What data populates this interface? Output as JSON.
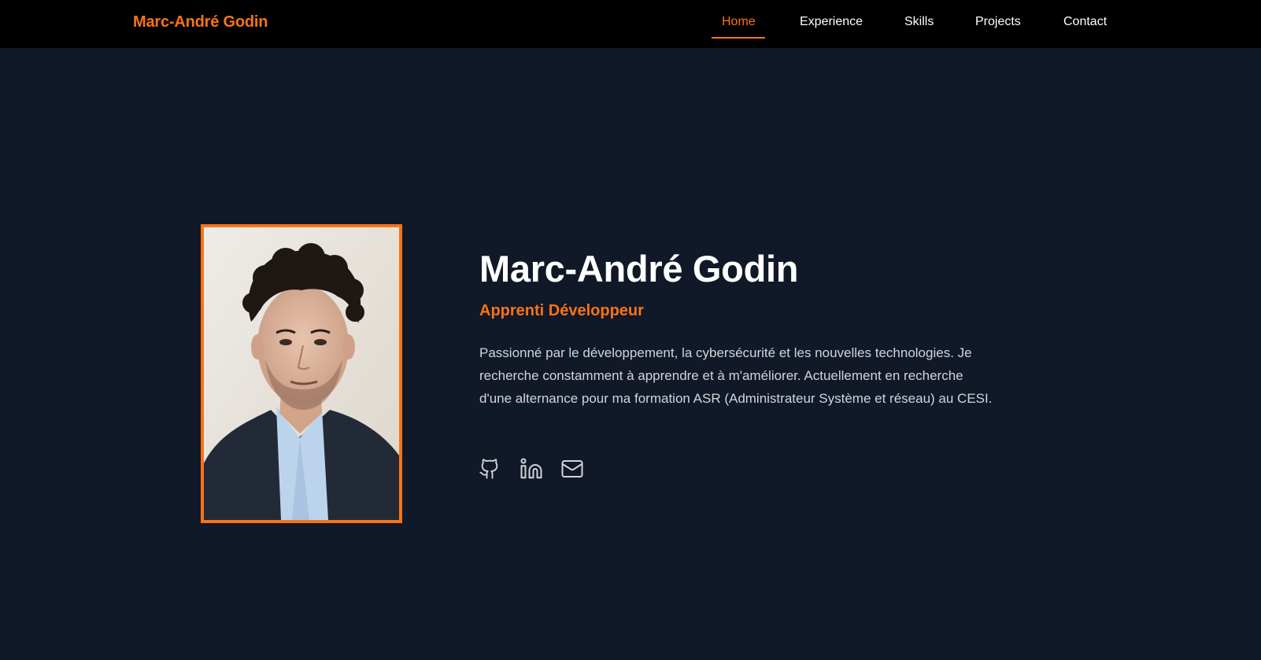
{
  "nav": {
    "brand": "Marc-André Godin",
    "links": [
      {
        "label": "Home",
        "active": true
      },
      {
        "label": "Experience",
        "active": false
      },
      {
        "label": "Skills",
        "active": false
      },
      {
        "label": "Projects",
        "active": false
      },
      {
        "label": "Contact",
        "active": false
      }
    ]
  },
  "hero": {
    "name": "Marc-André Godin",
    "role": "Apprenti Développeur",
    "bio": "Passionné par le développement, la cybersécurité et les nouvelles technologies. Je recherche constamment à apprendre et à m'améliorer. Actuellement en recherche d'une alternance pour ma formation ASR (Administrateur Système et réseau) au CESI.",
    "photo_alt": "Marc-André Godin",
    "socials": [
      {
        "icon": "github-icon"
      },
      {
        "icon": "linkedin-icon"
      },
      {
        "icon": "mail-icon"
      }
    ]
  },
  "colors": {
    "accent": "#f97316",
    "navbar_bg": "#000000",
    "page_bg": "#111827",
    "heading": "#ffffff",
    "body_text": "#d1d5db"
  }
}
